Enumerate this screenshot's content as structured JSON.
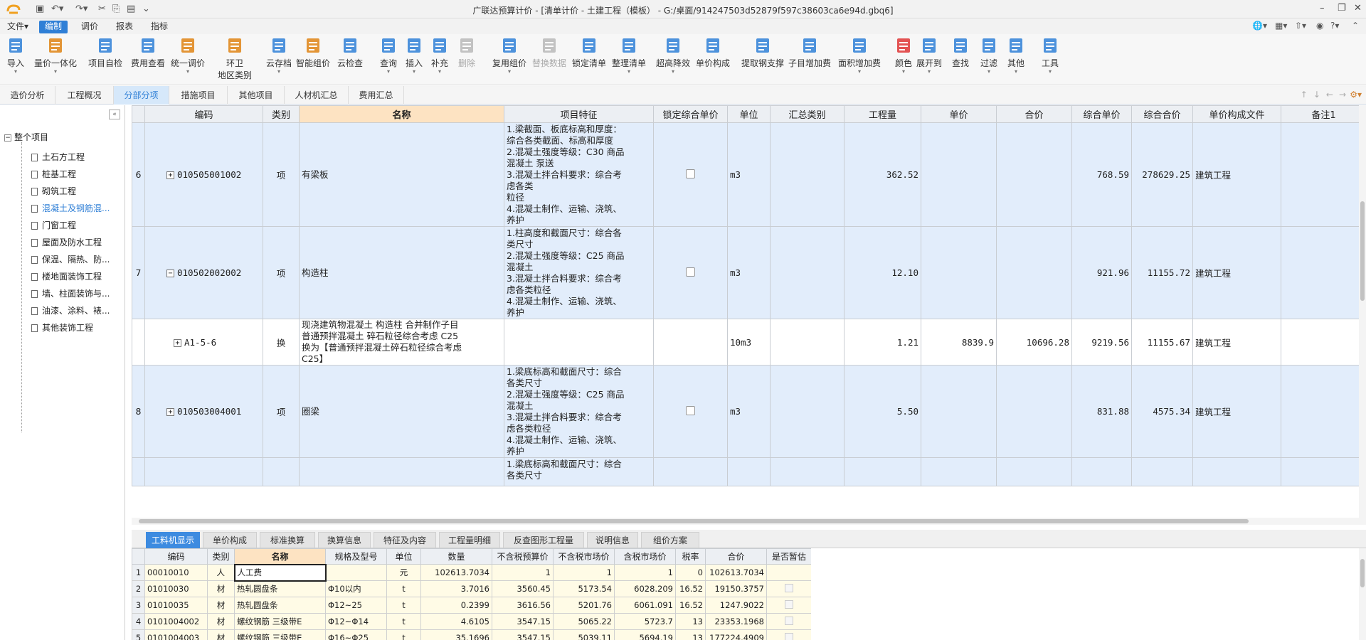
{
  "titlebar": {
    "title": "广联达预算计价 - [清单计价 - 土建工程（模板） - G:/桌面/914247503d52879f597c38603ca6e94d.gbq6]"
  },
  "menu": {
    "items": [
      "文件▾",
      "编制",
      "调价",
      "报表",
      "指标"
    ],
    "active": "编制"
  },
  "ribbon": {
    "buttons": [
      {
        "label": "导入",
        "icon": "import-icon",
        "caret": true
      },
      {
        "label": "量价一体化",
        "icon": "qty-price-icon",
        "caret": true
      },
      {
        "label": "项目自检",
        "icon": "self-check-icon",
        "caret": false
      },
      {
        "label": "费用查看",
        "icon": "fee-view-icon",
        "caret": false
      },
      {
        "label": "统一调价",
        "icon": "unify-price-icon",
        "caret": true
      },
      {
        "label": "环卫\n地区类别",
        "icon": "region-icon",
        "caret": false
      },
      {
        "label": "云存档",
        "icon": "cloud-save-icon",
        "caret": true
      },
      {
        "label": "智能组价",
        "icon": "smart-price-icon",
        "caret": false
      },
      {
        "label": "云检查",
        "icon": "cloud-check-icon",
        "caret": false
      },
      {
        "label": "查询",
        "icon": "query-icon",
        "caret": true
      },
      {
        "label": "插入",
        "icon": "insert-icon",
        "caret": true
      },
      {
        "label": "补充",
        "icon": "supplement-icon",
        "caret": true
      },
      {
        "label": "删除",
        "icon": "delete-icon",
        "caret": false,
        "disabled": true
      },
      {
        "label": "复用组价",
        "icon": "reuse-icon",
        "caret": true
      },
      {
        "label": "替换数据",
        "icon": "replace-icon",
        "caret": false,
        "disabled": true
      },
      {
        "label": "锁定清单",
        "icon": "lock-icon",
        "caret": false
      },
      {
        "label": "整理清单",
        "icon": "organize-icon",
        "caret": true
      },
      {
        "label": "超高降效",
        "icon": "height-icon",
        "caret": true
      },
      {
        "label": "单价构成",
        "icon": "unit-price-icon",
        "caret": false
      },
      {
        "label": "提取钢支撑",
        "icon": "steel-icon",
        "caret": false
      },
      {
        "label": "子目增加费",
        "icon": "sub-fee-icon",
        "caret": false
      },
      {
        "label": "面积增加费",
        "icon": "area-fee-icon",
        "caret": true
      },
      {
        "label": "颜色",
        "icon": "color-icon",
        "caret": true
      },
      {
        "label": "展开到",
        "icon": "expand-icon",
        "caret": true
      },
      {
        "label": "查找",
        "icon": "find-icon",
        "caret": false
      },
      {
        "label": "过滤",
        "icon": "filter-icon",
        "caret": true
      },
      {
        "label": "其他",
        "icon": "other-icon",
        "caret": true
      },
      {
        "label": "工具",
        "icon": "tools-icon",
        "caret": true
      }
    ]
  },
  "tabs": [
    "造价分析",
    "工程概况",
    "分部分项",
    "措施项目",
    "其他项目",
    "人材机汇总",
    "费用汇总"
  ],
  "active_tab": "分部分项",
  "tree": {
    "root": "整个项目",
    "nodes": [
      "土石方工程",
      "桩基工程",
      "砌筑工程",
      "混凝土及钢筋混...",
      "门窗工程",
      "屋面及防水工程",
      "保温、隔热、防...",
      "楼地面装饰工程",
      "墙、柱面装饰与...",
      "油漆、涂料、裱...",
      "其他装饰工程"
    ],
    "selected": 3
  },
  "grid": {
    "headers": [
      "",
      "编码",
      "类别",
      "名称",
      "项目特征",
      "锁定综合单价",
      "单位",
      "汇总类别",
      "工程量",
      "单价",
      "合价",
      "综合单价",
      "综合合价",
      "单价构成文件",
      "备注1"
    ],
    "rows": [
      {
        "idx": "6",
        "expand": "+",
        "code": "010505001002",
        "type": "项",
        "name": "有梁板",
        "feature": "1.梁截面、板底标高和厚度：\n综合各类截面、标高和厚度\n2.混凝土强度等级：C30 商品\n混凝土 泵送\n3.混凝土拌合料要求：综合考\n虑各类\n粒径\n4.混凝土制作、运输、浇筑、\n养护",
        "lock": true,
        "unit": "m3",
        "qty": "362.52",
        "price": "",
        "total": "",
        "comp_price": "768.59",
        "comp_total": "278629.25",
        "file": "建筑工程",
        "blue": true,
        "h": 129
      },
      {
        "idx": "7",
        "expand": "−",
        "code": "010502002002",
        "type": "项",
        "name": "构造柱",
        "feature": "1.柱高度和截面尺寸：综合各\n类尺寸\n2.混凝土强度等级：C25 商品\n混凝土\n3.混凝土拌合料要求：综合考\n虑各类粒径\n4.混凝土制作、运输、浇筑、\n养护",
        "lock": true,
        "unit": "m3",
        "qty": "12.10",
        "price": "",
        "total": "",
        "comp_price": "921.96",
        "comp_total": "11155.72",
        "file": "建筑工程",
        "blue": true,
        "h": 116
      },
      {
        "idx": "",
        "expand": "+",
        "code": "A1-5-6",
        "type": "换",
        "name": "现浇建筑物混凝土 构造柱  合并制作子目\n普通预拌混凝土 碎石粒径综合考虑 C25\n 换为【普通预拌混凝土碎石粒径综合考虑\nC25】",
        "feature": "",
        "lock": false,
        "unit": "10m3",
        "qty": "1.21",
        "price": "8839.9",
        "total": "10696.28",
        "comp_price": "9219.56",
        "comp_total": "11155.67",
        "file": "建筑工程",
        "blue": false,
        "h": 60
      },
      {
        "idx": "8",
        "expand": "+",
        "code": "010503004001",
        "type": "项",
        "name": "圈梁",
        "feature": "1.梁底标高和截面尺寸：综合\n各类尺寸\n2.混凝土强度等级：C25 商品\n混凝土\n3.混凝土拌合料要求：综合考\n虑各类粒径\n4.混凝土制作、运输、浇筑、\n养护",
        "lock": true,
        "unit": "m3",
        "qty": "5.50",
        "price": "",
        "total": "",
        "comp_price": "831.88",
        "comp_total": "4575.34",
        "file": "建筑工程",
        "blue": true,
        "h": 116
      },
      {
        "idx": "",
        "expand": "",
        "code": "",
        "type": "",
        "name": "",
        "feature": "1.梁底标高和截面尺寸：综合\n各类尺寸",
        "lock": false,
        "unit": "",
        "qty": "",
        "price": "",
        "total": "",
        "comp_price": "",
        "comp_total": "",
        "file": "",
        "blue": true,
        "h": 40
      }
    ]
  },
  "bottom_tabs": [
    "工料机显示",
    "单价构成",
    "标准换算",
    "换算信息",
    "特征及内容",
    "工程量明细",
    "反查图形工程量",
    "说明信息",
    "组价方案"
  ],
  "bottom_active": "工料机显示",
  "subgrid": {
    "headers": [
      "",
      "编码",
      "类别",
      "名称",
      "规格及型号",
      "单位",
      "数量",
      "不含税预算价",
      "不含税市场价",
      "含税市场价",
      "税率",
      "合价",
      "是否暂估"
    ],
    "rows": [
      [
        "1",
        "00010010",
        "人",
        "人工费",
        "",
        "元",
        "102613.7034",
        "1",
        "1",
        "1",
        "0",
        "102613.7034",
        ""
      ],
      [
        "2",
        "01010030",
        "材",
        "热轧圆盘条",
        "Φ10以内",
        "t",
        "3.7016",
        "3560.45",
        "5173.54",
        "6028.209",
        "16.52",
        "19150.3757",
        "chk"
      ],
      [
        "3",
        "01010035",
        "材",
        "热轧圆盘条",
        "Φ12~25",
        "t",
        "0.2399",
        "3616.56",
        "5201.76",
        "6061.091",
        "16.52",
        "1247.9022",
        "chk"
      ],
      [
        "4",
        "0101004002",
        "材",
        "螺纹钢筋 三级带E",
        "Φ12~Φ14",
        "t",
        "4.6105",
        "3547.15",
        "5065.22",
        "5723.7",
        "13",
        "23353.1968",
        "chk"
      ],
      [
        "5",
        "0101004003",
        "材",
        "螺纹钢筋 三级带E",
        "Φ16~Φ25",
        "t",
        "35.1696",
        "3547.15",
        "5039.11",
        "5694.19",
        "13",
        "177224.4909",
        "chk"
      ]
    ]
  }
}
